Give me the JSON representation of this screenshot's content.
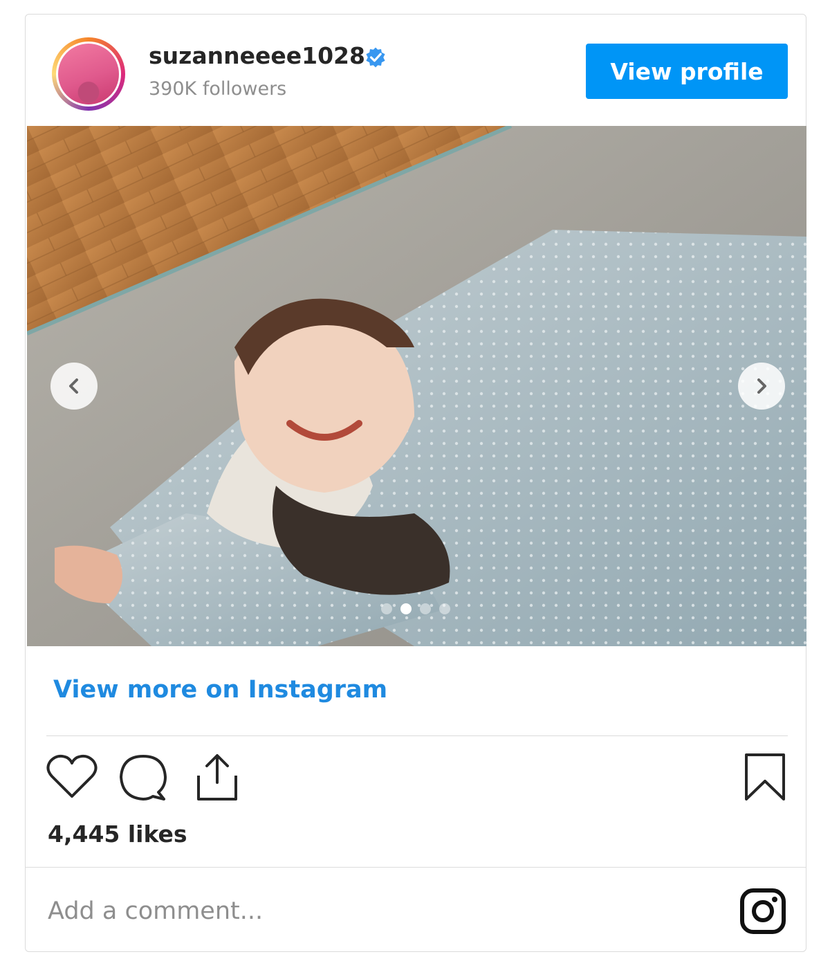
{
  "header": {
    "username": "suzanneeee1028",
    "followers": "390K followers",
    "view_profile_label": "View profile"
  },
  "carousel": {
    "slide_count": 4,
    "active_index": 1
  },
  "view_more_label": "View more on Instagram",
  "likes": "4,445 likes",
  "comment": {
    "placeholder": "Add a comment..."
  },
  "icons": [
    "verified-badge-icon",
    "chevron-left-icon",
    "chevron-right-icon",
    "heart-icon",
    "comment-icon",
    "share-icon",
    "bookmark-icon",
    "instagram-logo-icon"
  ],
  "colors": {
    "accent": "#0095f6",
    "link": "#1f8ae0",
    "text": "#262626",
    "muted": "#8e8e8e"
  }
}
